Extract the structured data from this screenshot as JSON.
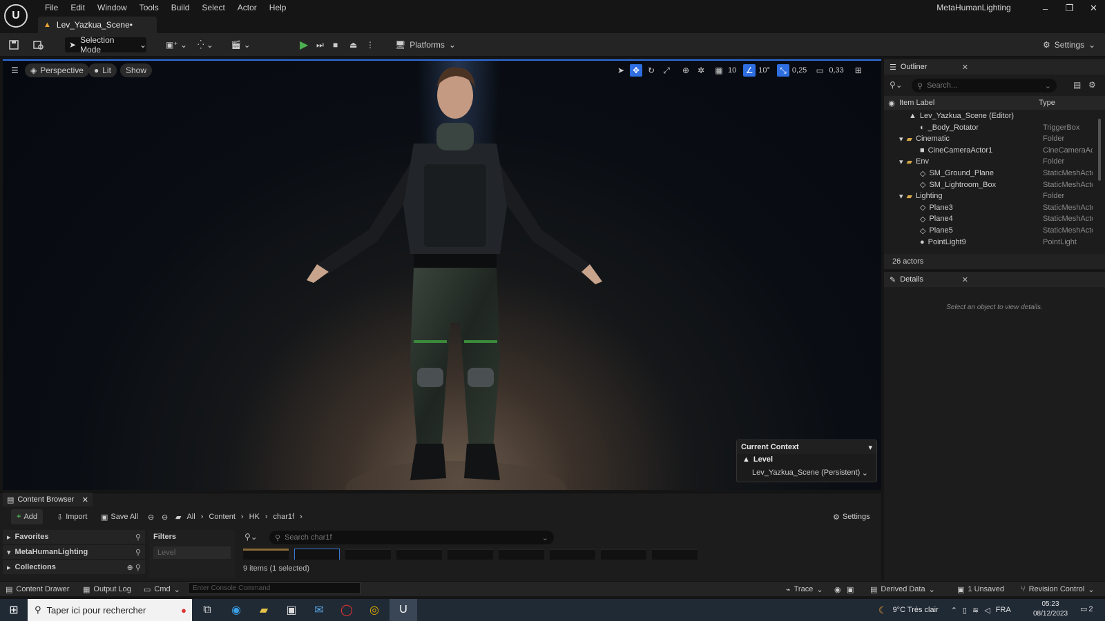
{
  "window": {
    "project_name": "MetaHumanLighting",
    "minimize": "–",
    "restore": "❐",
    "close": "✕"
  },
  "menu": [
    "File",
    "Edit",
    "Window",
    "Tools",
    "Build",
    "Select",
    "Actor",
    "Help"
  ],
  "document_tab": "Lev_Yazkua_Scene•",
  "toolbar": {
    "selection_mode": "Selection Mode",
    "platforms": "Platforms",
    "settings": "Settings"
  },
  "viewport": {
    "view_mode": "Perspective",
    "lighting": "Lit",
    "show": "Show",
    "grid_snap": "10",
    "rotation_snap": "10°",
    "scale_snap": "0,25",
    "camera_speed": "0,33"
  },
  "current_context": {
    "title": "Current Context",
    "level_label": "Level",
    "level_value": "Lev_Yazkua_Scene (Persistent)"
  },
  "outliner": {
    "title": "Outliner",
    "search_placeholder": "Search...",
    "col_label": "Item Label",
    "col_type": "Type",
    "rows": [
      {
        "label": "Lev_Yazkua_Scene (Editor)",
        "type": "",
        "icon": "level-icon",
        "kind": "root"
      },
      {
        "label": "_Body_Rotator",
        "type": "TriggerBox",
        "icon": "actor-icon",
        "kind": "item"
      },
      {
        "label": "Cinematic",
        "type": "Folder",
        "icon": "folder-icon",
        "kind": "folder"
      },
      {
        "label": "CineCameraActor1",
        "type": "CineCameraAct",
        "icon": "camera-icon",
        "kind": "item"
      },
      {
        "label": "Env",
        "type": "Folder",
        "icon": "folder-icon",
        "kind": "folder"
      },
      {
        "label": "SM_Ground_Plane",
        "type": "StaticMeshActo",
        "icon": "mesh-icon",
        "kind": "item"
      },
      {
        "label": "SM_Lightroom_Box",
        "type": "StaticMeshActo",
        "icon": "mesh-icon",
        "kind": "item"
      },
      {
        "label": "Lighting",
        "type": "Folder",
        "icon": "folder-icon",
        "kind": "folder"
      },
      {
        "label": "Plane3",
        "type": "StaticMeshActo",
        "icon": "mesh-icon",
        "kind": "item"
      },
      {
        "label": "Plane4",
        "type": "StaticMeshActo",
        "icon": "mesh-icon",
        "kind": "item"
      },
      {
        "label": "Plane5",
        "type": "StaticMeshActo",
        "icon": "mesh-icon",
        "kind": "item"
      },
      {
        "label": "PointLight9",
        "type": "PointLight",
        "icon": "light-icon",
        "kind": "item"
      }
    ],
    "count": "26 actors"
  },
  "details": {
    "title": "Details",
    "empty_message": "Select an object to view details."
  },
  "content_browser": {
    "title": "Content Browser",
    "add": "Add",
    "import": "Import",
    "save_all": "Save All",
    "settings": "Settings",
    "breadcrumb": [
      "All",
      "Content",
      "HK",
      "char1f"
    ],
    "sections": [
      "Favorites",
      "MetaHumanLighting",
      "Collections"
    ],
    "filters_label": "Filters",
    "filter_level": "Level",
    "search_placeholder": "Search char1f",
    "items_count": "9 items (1 selected)"
  },
  "status_bar": {
    "content_drawer": "Content Drawer",
    "output_log": "Output Log",
    "cmd": "Cmd",
    "console_placeholder": "Enter Console Command",
    "trace": "Trace",
    "derived_data": "Derived Data",
    "unsaved": "1 Unsaved",
    "revision_control": "Revision Control"
  },
  "taskbar": {
    "search_placeholder": "Taper ici pour rechercher",
    "weather": "9°C  Très clair",
    "language": "FRA",
    "time": "05:23",
    "date": "08/12/2023",
    "notifications": "2"
  }
}
